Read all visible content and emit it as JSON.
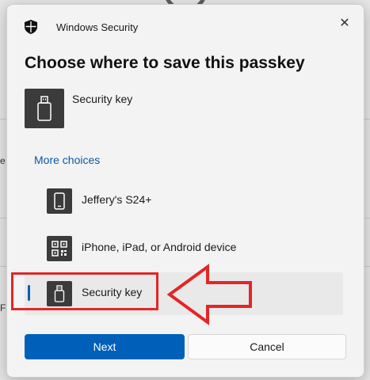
{
  "background": {
    "fragment_1": "e",
    "fragment_2": "F"
  },
  "dialog": {
    "app_title": "Windows Security",
    "close_glyph": "✕",
    "heading": "Choose where to save this passkey",
    "selected_option": {
      "label": "Security key",
      "icon": "usb-key-icon"
    },
    "more_choices_label": "More choices",
    "options": [
      {
        "label": "Jeffery's S24+",
        "icon": "phone-icon",
        "selected": false
      },
      {
        "label": "iPhone, iPad, or Android device",
        "icon": "qr-code-icon",
        "selected": false
      },
      {
        "label": "Security key",
        "icon": "usb-key-icon",
        "selected": true
      }
    ],
    "buttons": {
      "next": "Next",
      "cancel": "Cancel"
    }
  },
  "annotation": {
    "highlight_color": "#e32626"
  },
  "colors": {
    "accent": "#005fb8",
    "icon_tile": "#3b3b3b",
    "link": "#0a58a6"
  }
}
